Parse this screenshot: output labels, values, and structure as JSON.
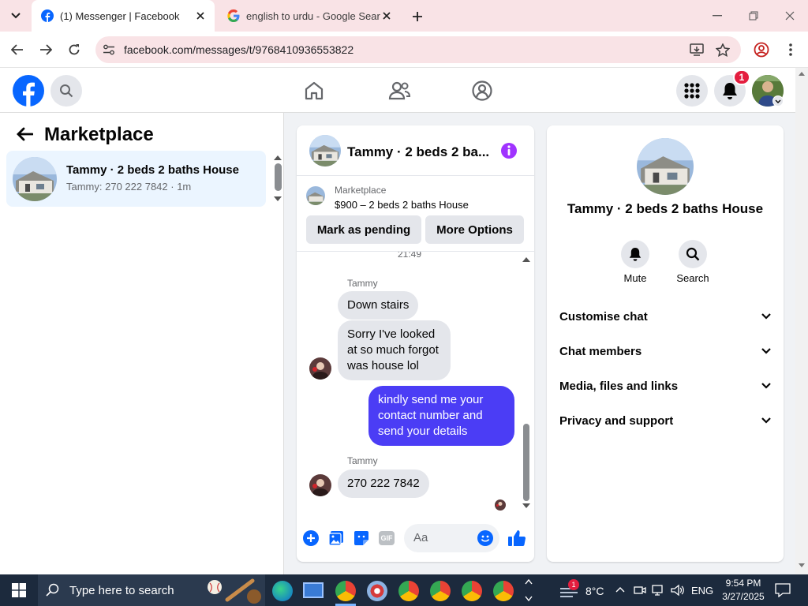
{
  "browser": {
    "tabs": [
      {
        "title": "(1) Messenger | Facebook",
        "active": true
      },
      {
        "title": "english to urdu - Google Search",
        "active": false
      }
    ],
    "url": "facebook.com/messages/t/9768410936553822"
  },
  "fb_header": {
    "notification_count": "1"
  },
  "left_panel": {
    "title": "Marketplace",
    "conversations": [
      {
        "name": "Tammy · 2 beds 2 baths House",
        "preview": "Tammy: 270 222 7842 · 1m"
      }
    ]
  },
  "chat": {
    "title": "Tammy · 2 beds 2 ba...",
    "listing": {
      "category": "Marketplace",
      "price_title": "$900 – 2 beds 2 baths House"
    },
    "mark_pending_label": "Mark as pending",
    "more_options_label": "More Options",
    "timestamp": "21:49",
    "messages": [
      {
        "sender": "Tammy",
        "text": "Down stairs"
      },
      {
        "text": "Sorry I've looked at so much forgot was house lol"
      },
      {
        "text": "kindly send me your contact number and send your details",
        "outgoing": true
      },
      {
        "sender": "Tammy",
        "text": "270 222 7842"
      }
    ],
    "composer_placeholder": "Aa",
    "gif_label": "GIF"
  },
  "info_panel": {
    "title": "Tammy · 2 beds 2 baths House",
    "mute_label": "Mute",
    "search_label": "Search",
    "sections": [
      "Customise chat",
      "Chat members",
      "Media, files and links",
      "Privacy and support"
    ]
  },
  "taskbar": {
    "search_placeholder": "Type here to search",
    "weather": "8°C",
    "weather_badge": "1",
    "language": "ENG",
    "time": "9:54 PM",
    "date": "3/27/2025"
  },
  "colors": {
    "fb_blue": "#0866ff",
    "outgoing_bubble": "#4b3df5",
    "info_purple": "#a033ff",
    "notification_red": "#e41e3f"
  }
}
